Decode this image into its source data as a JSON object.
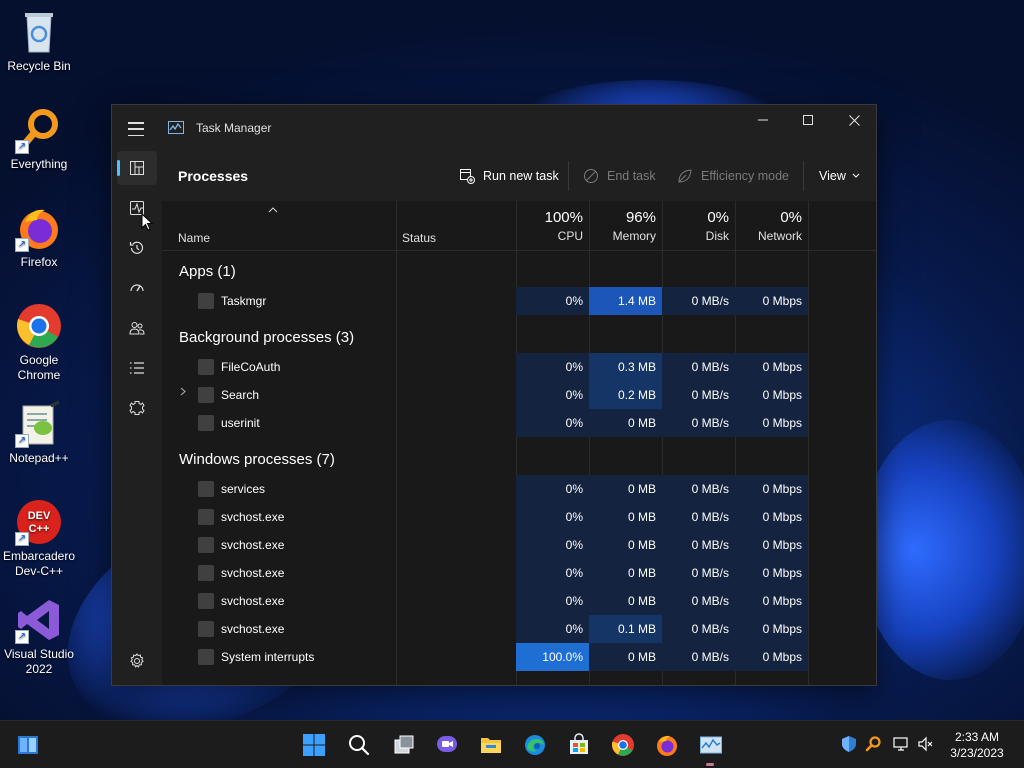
{
  "desktop": {
    "icons": [
      {
        "label": "Recycle Bin"
      },
      {
        "label": "Everything"
      },
      {
        "label": "Firefox"
      },
      {
        "label": "Google Chrome"
      },
      {
        "label": "Notepad++"
      },
      {
        "label": "Embarcadero Dev-C++"
      },
      {
        "label": "Visual Studio 2022"
      }
    ]
  },
  "window": {
    "title": "Task Manager",
    "controls": {
      "minimize": "–",
      "maximize": "☐",
      "close": "✕"
    }
  },
  "nav": {
    "items": [
      {
        "icon": "processes-icon",
        "active": true
      },
      {
        "icon": "performance-icon"
      },
      {
        "icon": "app-history-icon"
      },
      {
        "icon": "startup-apps-icon"
      },
      {
        "icon": "users-icon"
      },
      {
        "icon": "details-icon"
      },
      {
        "icon": "services-icon"
      }
    ],
    "settings_icon": "gear-icon"
  },
  "toolbar": {
    "page_title": "Processes",
    "run_new_task": "Run new task",
    "end_task": "End task",
    "efficiency_mode": "Efficiency mode",
    "view": "View"
  },
  "table": {
    "headers": {
      "name": "Name",
      "status": "Status",
      "cpu_pct": "100%",
      "cpu": "CPU",
      "memory_pct": "96%",
      "memory": "Memory",
      "disk_pct": "0%",
      "disk": "Disk",
      "network_pct": "0%",
      "network": "Network"
    },
    "groups": [
      {
        "title": "Apps (1)",
        "rows": [
          {
            "name": "Taskmgr",
            "cpu": "0%",
            "memory": "1.4 MB",
            "disk": "0 MB/s",
            "network": "0 Mbps"
          }
        ]
      },
      {
        "title": "Background processes (3)",
        "rows": [
          {
            "name": "FileCoAuth",
            "cpu": "0%",
            "memory": "0.3 MB",
            "disk": "0 MB/s",
            "network": "0 Mbps"
          },
          {
            "name": "Search",
            "cpu": "0%",
            "memory": "0.2 MB",
            "disk": "0 MB/s",
            "network": "0 Mbps"
          },
          {
            "name": "userinit",
            "cpu": "0%",
            "memory": "0 MB",
            "disk": "0 MB/s",
            "network": "0 Mbps"
          }
        ]
      },
      {
        "title": "Windows processes (7)",
        "rows": [
          {
            "name": "services",
            "cpu": "0%",
            "memory": "0 MB",
            "disk": "0 MB/s",
            "network": "0 Mbps"
          },
          {
            "name": "svchost.exe",
            "cpu": "0%",
            "memory": "0 MB",
            "disk": "0 MB/s",
            "network": "0 Mbps"
          },
          {
            "name": "svchost.exe",
            "cpu": "0%",
            "memory": "0 MB",
            "disk": "0 MB/s",
            "network": "0 Mbps"
          },
          {
            "name": "svchost.exe",
            "cpu": "0%",
            "memory": "0 MB",
            "disk": "0 MB/s",
            "network": "0 Mbps"
          },
          {
            "name": "svchost.exe",
            "cpu": "0%",
            "memory": "0 MB",
            "disk": "0 MB/s",
            "network": "0 Mbps"
          },
          {
            "name": "svchost.exe",
            "cpu": "0%",
            "memory": "0.1 MB",
            "disk": "0 MB/s",
            "network": "0 Mbps"
          },
          {
            "name": "System interrupts",
            "cpu": "100.0%",
            "memory": "0 MB",
            "disk": "0 MB/s",
            "network": "0 Mbps"
          }
        ]
      }
    ]
  },
  "taskbar": {
    "apps": [
      "start-icon",
      "search-icon",
      "task-view-icon",
      "chat-icon",
      "file-explorer-icon",
      "edge-icon",
      "store-icon",
      "chrome-icon",
      "firefox-icon",
      "task-manager-icon"
    ],
    "clock_time": "2:33 AM",
    "clock_date": "3/23/2023"
  },
  "colors": {
    "accent": "#4cc2ff",
    "heat_low": "#142440",
    "heat_mid": "#163567",
    "heat_high": "#1b56b8",
    "heat_max": "#1f6ed4"
  }
}
